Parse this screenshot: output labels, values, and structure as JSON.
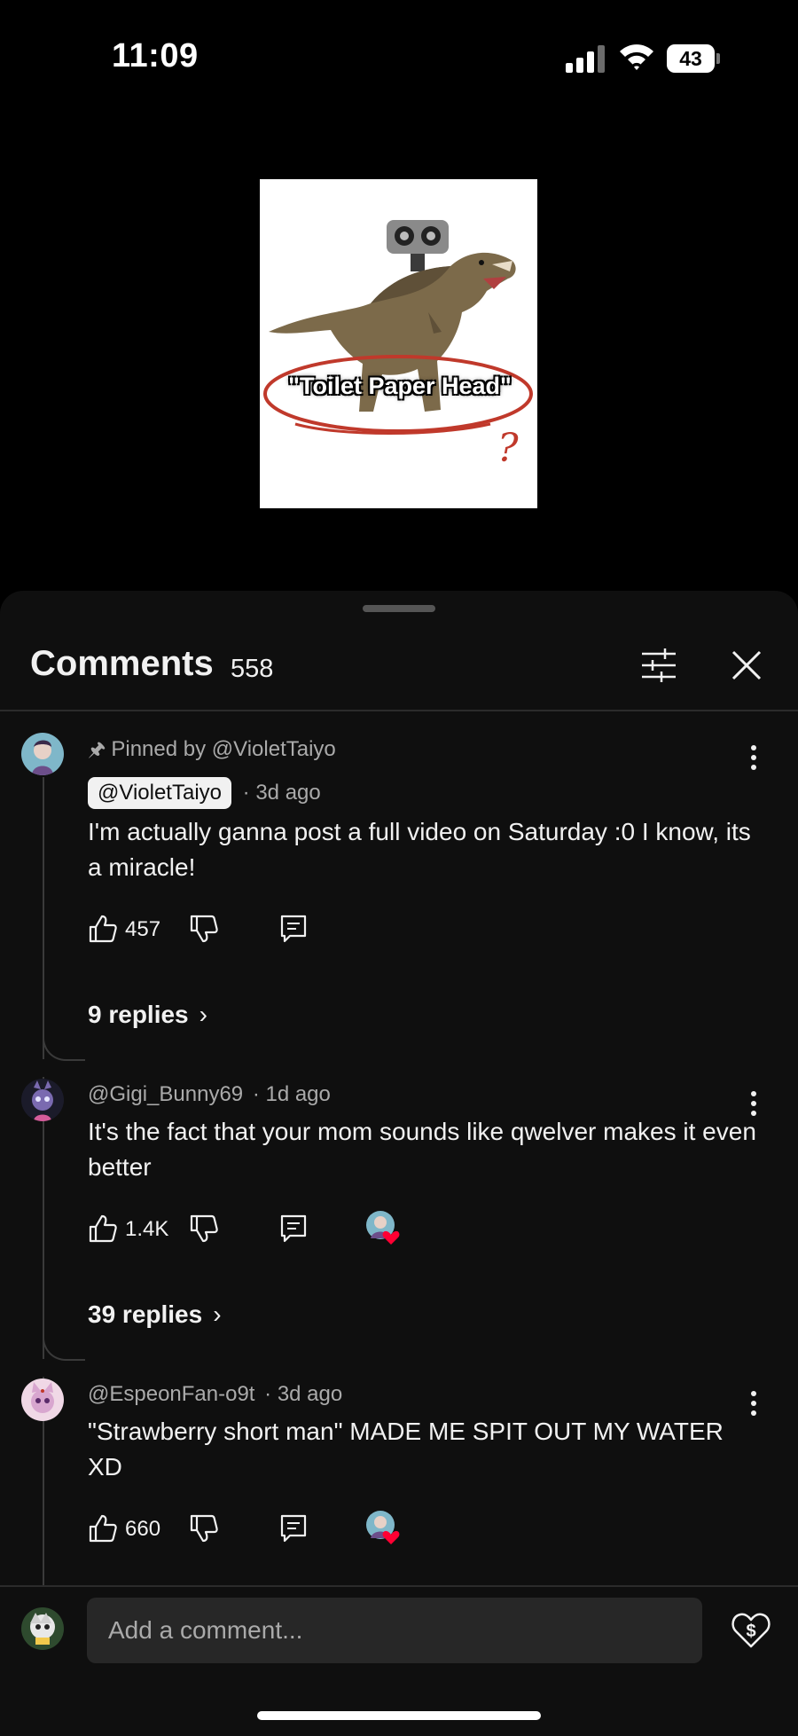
{
  "status_bar": {
    "time": "11:09",
    "battery": "43"
  },
  "video": {
    "thumbnail_caption": "\"Toilet Paper Head\"",
    "annotation_mark": "?"
  },
  "comments_panel": {
    "title": "Comments",
    "count": "558",
    "filter_icon": "sliders-icon",
    "close_icon": "close-icon",
    "comments": [
      {
        "pinned_label": "Pinned by @VioletTaiyo",
        "author": "@VioletTaiyo",
        "time": "· 3d ago",
        "text": "I'm actually ganna post a full video on Saturday :0 I know, its a miracle!",
        "likes": "457",
        "replies": "9 replies"
      },
      {
        "author": "@Gigi_Bunny69",
        "time": "· 1d ago",
        "text": "It's the fact that your mom sounds like qwelver makes it even better",
        "likes": "1.4K",
        "replies": "39 replies"
      },
      {
        "author": "@EspeonFan-o9t",
        "time": "· 3d ago",
        "text": "\"Strawberry short man\" MADE ME SPIT OUT MY WATER XD",
        "likes": "660"
      }
    ]
  },
  "composer": {
    "placeholder": "Add a comment...",
    "thanks_icon": "super-thanks-icon"
  },
  "colors": {
    "background": "#000000",
    "sheet": "#0f0f0f",
    "input": "#272727",
    "heart": "#ff0033"
  }
}
